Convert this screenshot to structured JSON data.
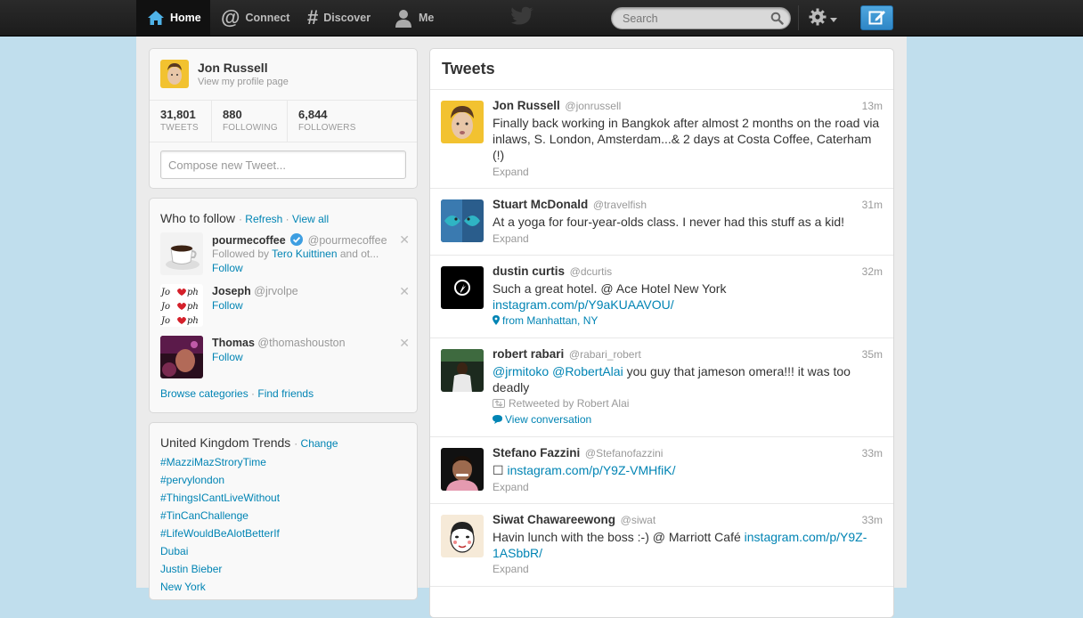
{
  "nav": {
    "home": "Home",
    "connect": "Connect",
    "discover": "Discover",
    "me": "Me"
  },
  "search": {
    "placeholder": "Search"
  },
  "icons": {
    "home": "home-icon",
    "connect": "at-icon",
    "discover": "hash-icon",
    "me": "person-icon",
    "bird": "twitter-bird-icon",
    "search": "search-icon",
    "settings": "gear-icon",
    "compose": "compose-icon"
  },
  "colors": {
    "link": "#0084b4",
    "background": "#c0deed",
    "topbar": "#1f1f1f",
    "compose": "#3b94d9"
  },
  "profile": {
    "name": "Jon Russell",
    "link": "View my profile page",
    "stats": [
      {
        "value": "31,801",
        "label": "TWEETS"
      },
      {
        "value": "880",
        "label": "FOLLOWING"
      },
      {
        "value": "6,844",
        "label": "FOLLOWERS"
      }
    ],
    "compose_placeholder": "Compose new Tweet..."
  },
  "who_to_follow": {
    "title": "Who to follow",
    "refresh": "Refresh",
    "view_all": "View all",
    "suggestions": [
      {
        "name": "pourmecoffee",
        "handle": "@pourmecoffee",
        "followed_by_prefix": "Followed by ",
        "followed_by_name": "Tero Kuittinen",
        "followed_by_suffix": " and ot...",
        "follow": "Follow"
      },
      {
        "name": "Joseph",
        "handle": "@jrvolpe",
        "follow": "Follow"
      },
      {
        "name": "Thomas",
        "handle": "@thomashouston",
        "follow": "Follow"
      }
    ],
    "browse": "Browse categories",
    "find_friends": "Find friends"
  },
  "trends": {
    "title": "United Kingdom Trends",
    "change": "Change",
    "items": [
      "#MazziMazStroryTime",
      "#pervylondon",
      "#ThingsICantLiveWithout",
      "#TinCanChallenge",
      "#LifeWouldBeAlotBetterIf",
      "Dubai",
      "Justin Bieber",
      "New York"
    ]
  },
  "timeline": {
    "title": "Tweets",
    "tweets": [
      {
        "name": "Jon Russell",
        "handle": "@jonrussell",
        "time": "13m",
        "text": "Finally back working in Bangkok after almost 2 months on the road via inlaws, S. London, Amsterdam...&  2 days at Costa Coffee, Caterham (!)",
        "action": "Expand"
      },
      {
        "name": "Stuart McDonald",
        "handle": "@travelfish",
        "time": "31m",
        "text": "At a yoga for four-year-olds class. I never had this stuff as a kid!",
        "action": "Expand"
      },
      {
        "name": "dustin curtis",
        "handle": "@dcurtis",
        "time": "32m",
        "text": "Such a great hotel. @ Ace Hotel New York",
        "link": "instagram.com/p/Y9aKUAAVOU/",
        "location": "from Manhattan, NY"
      },
      {
        "name": "robert rabari",
        "handle": "@rabari_robert",
        "time": "35m",
        "mention1": "@jrmitoko",
        "mention2": "@RobertAlai",
        "text": " you guy that jameson omera!!! it was too deadly",
        "retweeted": "Retweeted by Robert Alai",
        "conversation": "View conversation"
      },
      {
        "name": "Stefano Fazzini",
        "handle": "@Stefanofazzini",
        "time": "33m",
        "text": "☐ ",
        "link": "instagram.com/p/Y9Z-VMHfiK/",
        "action": "Expand"
      },
      {
        "name": "Siwat Chawareewong",
        "handle": "@siwat",
        "time": "33m",
        "text": "Havin lunch with the boss :-) @ Marriott Café ",
        "link": "instagram.com/p/Y9Z-1ASbbR/",
        "action": "Expand"
      }
    ]
  }
}
